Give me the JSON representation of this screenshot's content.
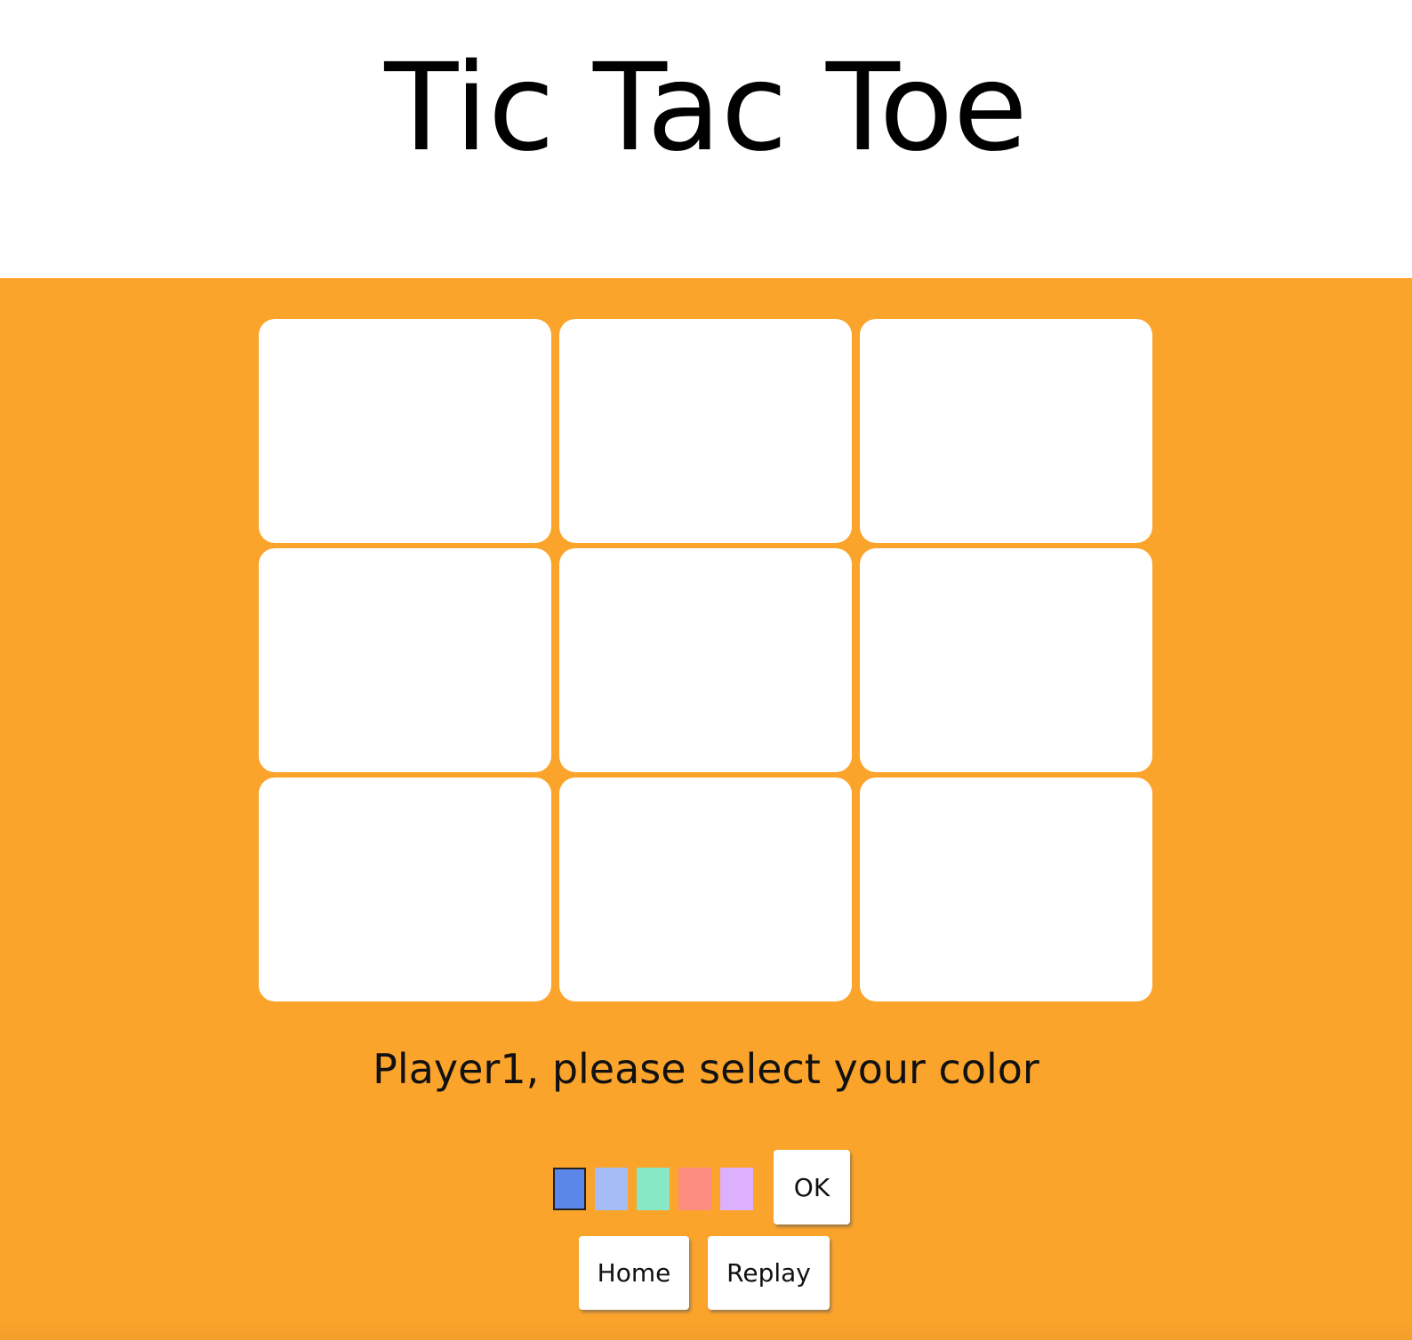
{
  "header": {
    "title": "Tic Tac Toe"
  },
  "board": {
    "rows": 3,
    "cols": 3,
    "cells": [
      "",
      "",
      "",
      "",
      "",
      "",
      "",
      "",
      ""
    ]
  },
  "prompt": "Player1, please select your color",
  "color_picker": {
    "selected_index": 0,
    "options": [
      "#5b87e8",
      "#a5bdf7",
      "#86e8c4",
      "#fc8d80",
      "#dcb0fc"
    ]
  },
  "buttons": {
    "ok_label": "OK",
    "home_label": "Home",
    "replay_label": "Replay"
  },
  "colors": {
    "background": "#fba42b",
    "cell": "#ffffff"
  }
}
